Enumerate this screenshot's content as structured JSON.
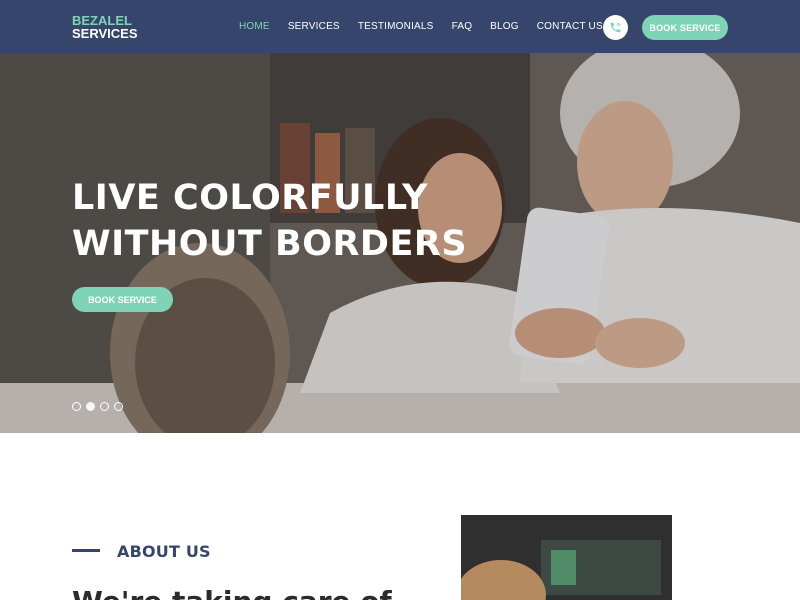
{
  "brand": {
    "line1": "BEZALEL",
    "line2": "SERVICES"
  },
  "nav": {
    "items": [
      {
        "label": "HOME",
        "active": true
      },
      {
        "label": "SERVICES",
        "active": false
      },
      {
        "label": "TESTIMONIALS",
        "active": false
      },
      {
        "label": "FAQ",
        "active": false
      },
      {
        "label": "BLOG",
        "active": false
      },
      {
        "label": "CONTACT US",
        "active": false
      }
    ],
    "phone_icon": "phone-icon",
    "book_label": "BOOK SERVICE"
  },
  "hero": {
    "title_line1": "LIVE COLORFULLY",
    "title_line2": "WITHOUT BORDERS",
    "button_label": "BOOK SERVICE",
    "slides": 4,
    "active_slide": 2
  },
  "about": {
    "label": "ABOUT US",
    "heading": "We're taking care of"
  },
  "colors": {
    "header_bg": "#36456b",
    "accent": "#7fd3b6",
    "dark_text": "#36456b"
  }
}
